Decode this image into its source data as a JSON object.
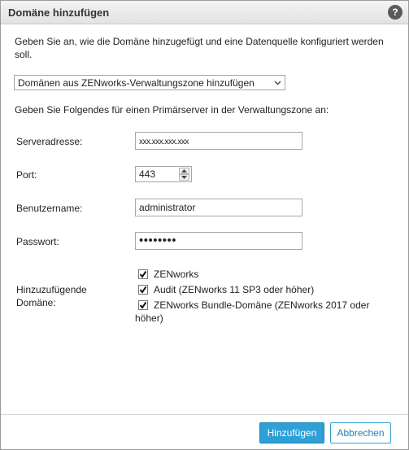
{
  "dialog": {
    "title": "Domäne hinzufügen",
    "help_icon": "help-icon",
    "help_glyph": "?"
  },
  "intro": "Geben Sie an, wie die Domäne hinzugefügt und eine Datenquelle konfiguriert werden soll.",
  "method_select": {
    "value": "Domänen aus ZENworks-Verwaltungszone hinzufügen"
  },
  "section_label": "Geben Sie Folgendes für einen Primärserver in der Verwaltungszone an:",
  "fields": {
    "server_address": {
      "label": "Serveradresse:",
      "value": "xxx.xxx.xxx.xxx"
    },
    "port": {
      "label": "Port:",
      "value": "443"
    },
    "username": {
      "label": "Benutzername:",
      "value": "administrator"
    },
    "password": {
      "label": "Passwort:",
      "value": "••••••••"
    }
  },
  "domains": {
    "label": "Hinzuzufügende Domäne:",
    "items": [
      {
        "label": "ZENworks",
        "checked": true
      },
      {
        "label": "Audit (ZENworks 11 SP3 oder höher)",
        "checked": true
      },
      {
        "label": "ZENworks Bundle-Domäne (ZENworks 2017 oder höher)",
        "checked": true
      }
    ]
  },
  "buttons": {
    "add": "Hinzufügen",
    "cancel": "Abbrechen"
  },
  "colors": {
    "primary": "#2ea0d6",
    "primary_border": "#1f86b8"
  }
}
